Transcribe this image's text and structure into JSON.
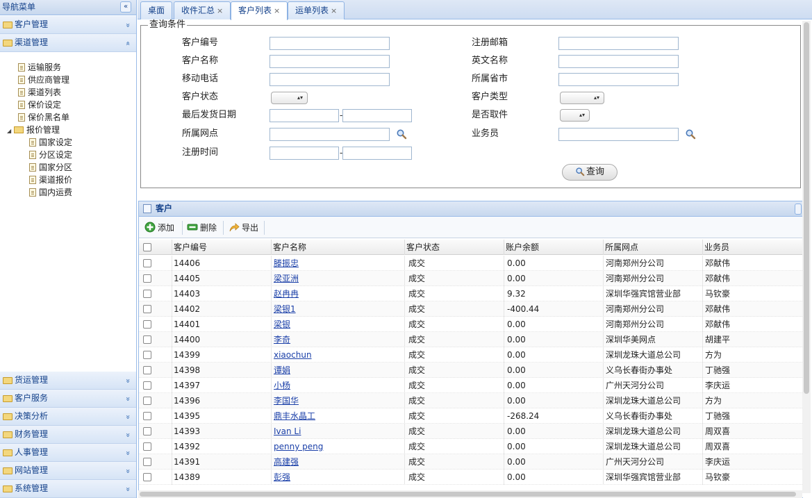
{
  "sidebar": {
    "title": "导航菜单",
    "collapse_glyph": "«",
    "top_sections": [
      {
        "label": "客户管理",
        "chevron": "»"
      },
      {
        "label": "渠道管理",
        "chevron": "«"
      }
    ],
    "tree": [
      {
        "label": "运输服务"
      },
      {
        "label": "供应商管理"
      },
      {
        "label": "渠道列表"
      },
      {
        "label": "保价设定"
      },
      {
        "label": "保价黑名单"
      },
      {
        "label": "报价管理"
      },
      {
        "label": "国家设定"
      },
      {
        "label": "分区设定"
      },
      {
        "label": "国家分区"
      },
      {
        "label": "渠道报价"
      },
      {
        "label": "国内运费"
      }
    ],
    "bottom_sections": [
      {
        "label": "货运管理"
      },
      {
        "label": "客户服务"
      },
      {
        "label": "决策分析"
      },
      {
        "label": "财务管理"
      },
      {
        "label": "人事管理"
      },
      {
        "label": "网站管理"
      },
      {
        "label": "系统管理"
      }
    ],
    "bottom_chevron": "»"
  },
  "tabs": [
    {
      "label": "桌面",
      "closable": false
    },
    {
      "label": "收件汇总",
      "closable": true
    },
    {
      "label": "客户列表",
      "closable": true
    },
    {
      "label": "运单列表",
      "closable": true
    }
  ],
  "tab_close_glyph": "×",
  "query": {
    "legend": "查询条件",
    "left_labels": [
      "客户编号",
      "客户名称",
      "移动电话",
      "客户状态",
      "最后发货日期",
      "所属网点",
      "注册时间"
    ],
    "right_labels": [
      "注册邮箱",
      "英文名称",
      "所属省市",
      "客户类型",
      "是否取件",
      "业务员"
    ],
    "range_dash": "-",
    "select_glyph": "▴▾",
    "search_button": "查询"
  },
  "grid": {
    "title": "客户",
    "toolbar": {
      "add": "添加",
      "delete": "删除",
      "export": "导出"
    },
    "columns": [
      "客户编号",
      "客户名称",
      "客户状态",
      "账户余额",
      "所属网点",
      "业务员"
    ],
    "rows": [
      [
        "14406",
        "滕振忠",
        "成交",
        "0.00",
        "河南郑州分公司",
        "邓献伟"
      ],
      [
        "14405",
        "梁亚洲",
        "成交",
        "0.00",
        "河南郑州分公司",
        "邓献伟"
      ],
      [
        "14403",
        "赵冉冉",
        "成交",
        "9.32",
        "深圳华强宾馆营业部",
        "马钦豪"
      ],
      [
        "14402",
        "梁银1",
        "成交",
        "-400.44",
        "河南郑州分公司",
        "邓献伟"
      ],
      [
        "14401",
        "梁银",
        "成交",
        "0.00",
        "河南郑州分公司",
        "邓献伟"
      ],
      [
        "14400",
        "李奇",
        "成交",
        "0.00",
        "深圳华美网点",
        "胡建平"
      ],
      [
        "14399",
        "xiaochun",
        "成交",
        "0.00",
        "深圳龙珠大道总公司",
        "方为"
      ],
      [
        "14398",
        "谭娟",
        "成交",
        "0.00",
        "义乌长春街办事处",
        "丁驰强"
      ],
      [
        "14397",
        "小杨",
        "成交",
        "0.00",
        "广州天河分公司",
        "李庆运"
      ],
      [
        "14396",
        "李国华",
        "成交",
        "0.00",
        "深圳龙珠大道总公司",
        "方为"
      ],
      [
        "14395",
        "鼎丰水晶工",
        "成交",
        "-268.24",
        "义乌长春街办事处",
        "丁驰强"
      ],
      [
        "14393",
        "Ivan Li",
        "成交",
        "0.00",
        "深圳龙珠大道总公司",
        "周双喜"
      ],
      [
        "14392",
        "penny peng",
        "成交",
        "0.00",
        "深圳龙珠大道总公司",
        "周双喜"
      ],
      [
        "14391",
        "高建强",
        "成交",
        "0.00",
        "广州天河分公司",
        "李庆运"
      ],
      [
        "14389",
        "彭强",
        "成交",
        "0.00",
        "深圳华强宾馆营业部",
        "马钦豪"
      ]
    ]
  },
  "colors": {
    "accent": "#15428b",
    "border": "#99bbe8",
    "link": "#1a3fa8",
    "folder": "#f3d77e"
  },
  "icons": {
    "search": "magnifier-icon",
    "add": "plus-icon",
    "delete": "minus-icon",
    "export": "export-arrow-icon"
  }
}
